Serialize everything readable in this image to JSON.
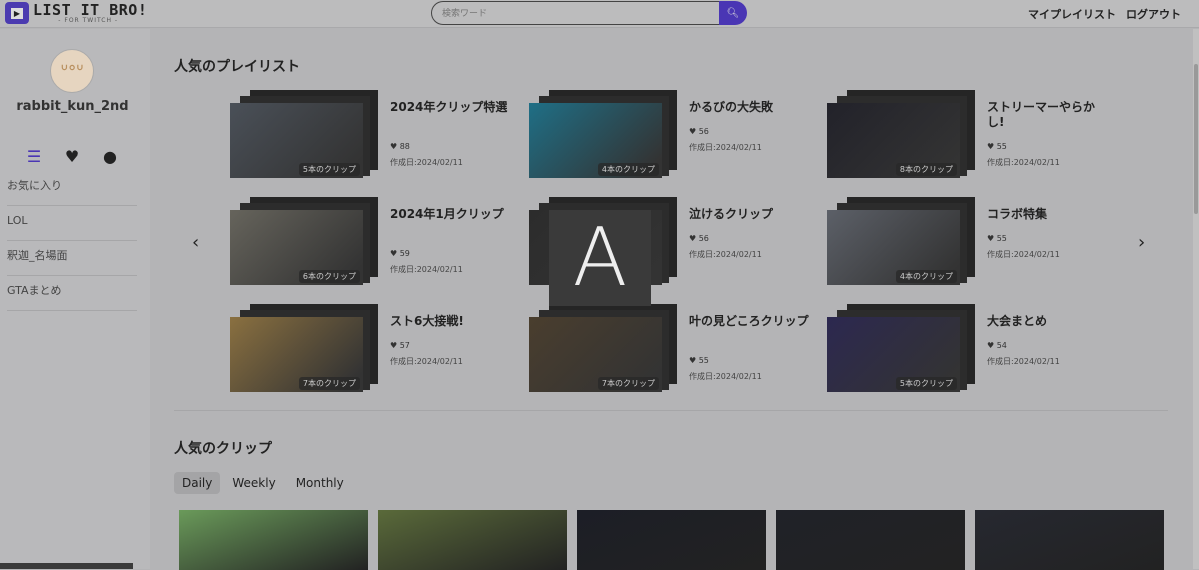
{
  "header": {
    "logo": "LIST IT BRO!",
    "logo_sub": "- FOR TWITCH -",
    "search_placeholder": "検索ワード",
    "nav": [
      "マイプレイリスト",
      "ログアウト"
    ]
  },
  "sidebar": {
    "username": "rabbit_kun_2nd",
    "items": [
      "お気に入り",
      "LOL",
      "釈迦_名場面",
      "GTAまとめ"
    ]
  },
  "playlists": {
    "title": "人気のプレイリスト",
    "items": [
      {
        "title": "2024年クリップ特選",
        "likes": "88",
        "date": "作成日:2024/02/11",
        "count": "5本のクリップ",
        "color": "#4a5058"
      },
      {
        "title": "かるびの大失敗",
        "likes": "56",
        "date": "作成日:2024/02/11",
        "count": "4本のクリップ",
        "color": "#1f6f86"
      },
      {
        "title": "ストリーマーやらかし!",
        "likes": "55",
        "date": "作成日:2024/02/11",
        "count": "8本のクリップ",
        "color": "#22222a"
      },
      {
        "title": "2024年1月クリップ",
        "likes": "59",
        "date": "作成日:2024/02/11",
        "count": "6本のクリップ",
        "color": "#66645c"
      },
      {
        "title": "泣けるクリップ",
        "likes": "56",
        "date": "作成日:2024/02/11",
        "count": "",
        "color": "#2c2c2c"
      },
      {
        "title": "コラボ特集",
        "likes": "55",
        "date": "作成日:2024/02/11",
        "count": "4本のクリップ",
        "color": "#5c6068"
      },
      {
        "title": "スト6大接戦!",
        "likes": "57",
        "date": "作成日:2024/02/11",
        "count": "7本のクリップ",
        "color": "#8a7040"
      },
      {
        "title": "叶の見どころクリップ",
        "likes": "55",
        "date": "作成日:2024/02/11",
        "count": "7本のクリップ",
        "color": "#4a3e2e"
      },
      {
        "title": "大会まとめ",
        "likes": "54",
        "date": "作成日:2024/02/11",
        "count": "5本のクリップ",
        "color": "#2c2850"
      }
    ]
  },
  "overlay_letter": "A",
  "clips": {
    "title": "人気のクリップ",
    "tabs": [
      "Daily",
      "Weekly",
      "Monthly"
    ],
    "thumb_colors": [
      "#6a9a5a",
      "#5a6a3a",
      "#1c1e26",
      "#202228",
      "#262830"
    ]
  }
}
